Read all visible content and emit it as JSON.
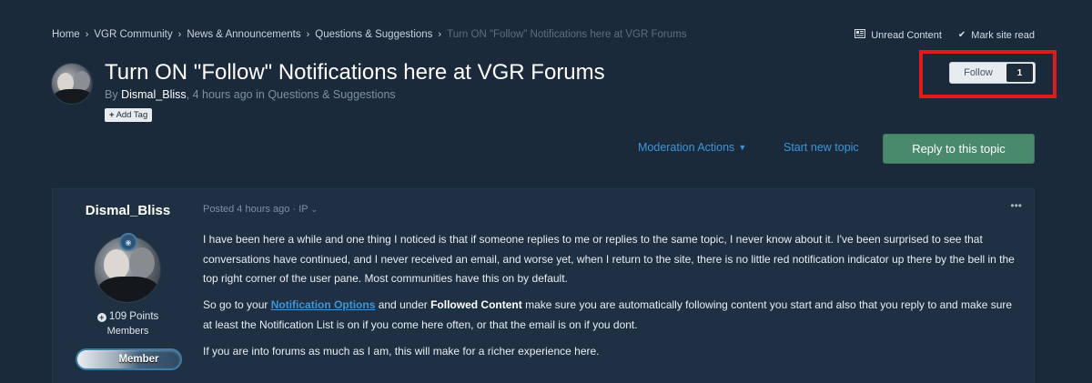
{
  "breadcrumb": {
    "items": [
      "Home",
      "VGR Community",
      "News & Announcements",
      "Questions & Suggestions"
    ],
    "current": "Turn ON \"Follow\" Notifications here at VGR Forums"
  },
  "top_actions": {
    "unread": "Unread Content",
    "mark_read": "Mark site read"
  },
  "topic": {
    "title": "Turn ON \"Follow\" Notifications here at VGR Forums",
    "by": "By",
    "author": "Dismal_Bliss",
    "time": "4 hours ago",
    "in": "in",
    "category": "Questions & Suggestions",
    "add_tag": "Add Tag"
  },
  "follow": {
    "label": "Follow",
    "count": "1",
    "highlight_color": "#e01b1b"
  },
  "actions": {
    "moderation": "Moderation Actions",
    "start_topic": "Start new topic",
    "reply": "Reply to this topic"
  },
  "post": {
    "author": "Dismal_Bliss",
    "points": "109 Points",
    "group": "Members",
    "badge": "Member",
    "meta_posted": "Posted 4 hours ago",
    "meta_ip": "IP",
    "menu": "•••",
    "p1": "I have been here a while and one thing I noticed is that if someone replies to me or replies to the same topic, I never know about it. I've been surprised to see that conversations have continued, and I never received an email, and worse yet, when I return to the site, there is no little red notification indicator up there by the bell in the top right corner of the user pane. Most communities have this on by default.",
    "p2_a": "So go to your ",
    "p2_link": "Notification Options",
    "p2_b": " and under ",
    "p2_bold": "Followed Content",
    "p2_c": " make sure you are automatically following content you start and also that you reply to and make sure at least the Notification List is on if you come here often, or that the email is on if you dont.",
    "p3": "If you are into forums as much as I am, this will make for a richer experience here."
  },
  "colors": {
    "background": "#1a2a3b",
    "link": "#3d95da",
    "reply_button": "#4a8a6c"
  }
}
